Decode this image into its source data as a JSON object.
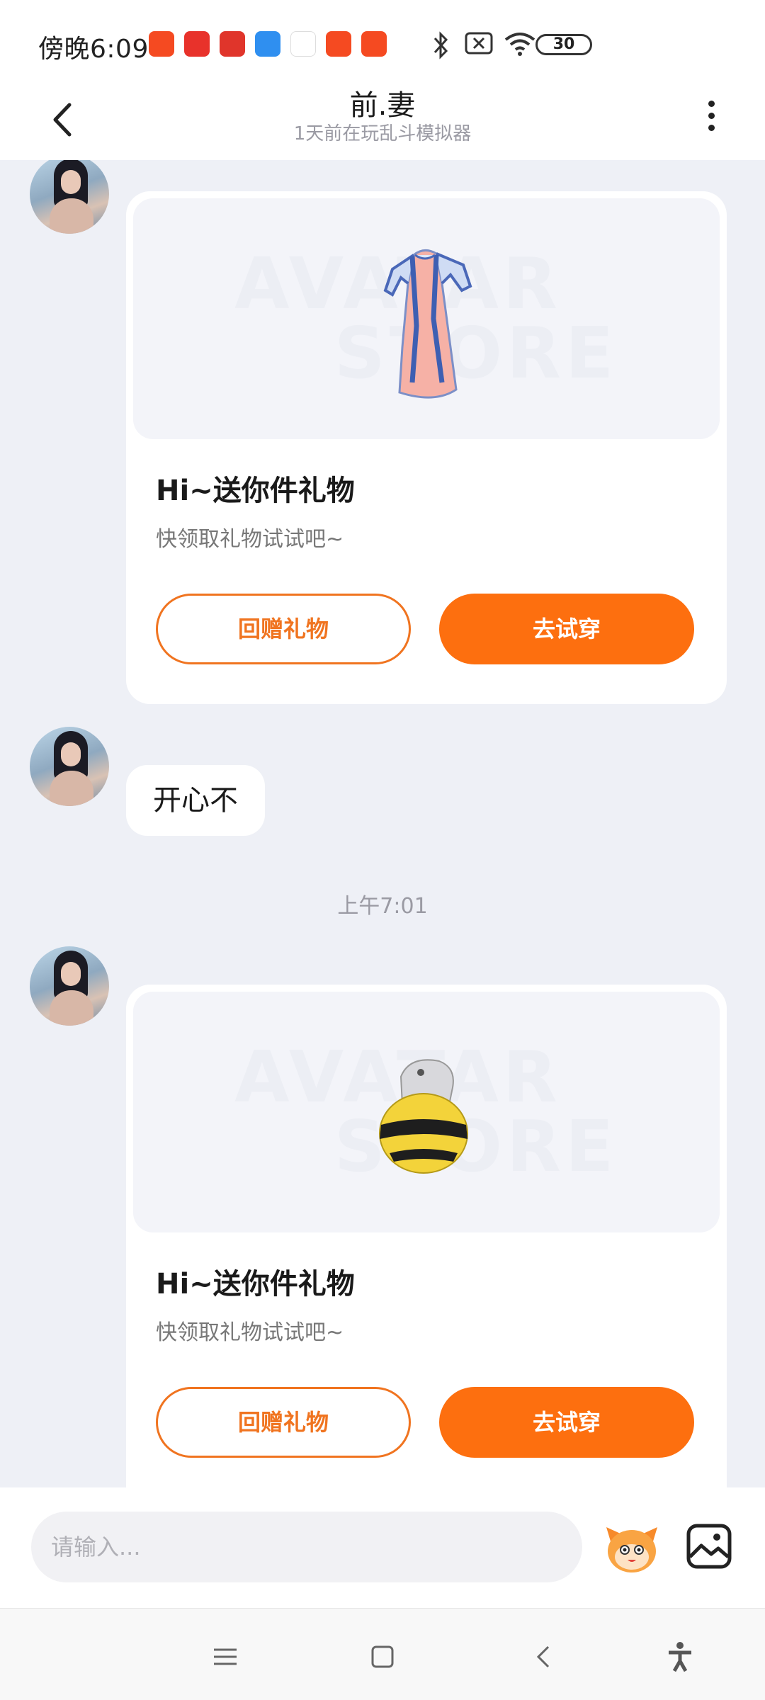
{
  "status_bar": {
    "time": "傍晚6:09",
    "battery": "30",
    "app_icon_colors": [
      "#f54a21",
      "#e8322b",
      "#e0352b",
      "#2f8ff0",
      "#ffffff",
      "#f54a21",
      "#f54a21"
    ],
    "icons": [
      "bluetooth-icon",
      "no-sim-icon",
      "wifi-icon",
      "battery-icon"
    ]
  },
  "header": {
    "title": "前.妻",
    "subtitle": "1天前在玩乱斗模拟器",
    "back_icon": "chevron-left-icon",
    "more_icon": "more-vertical-icon"
  },
  "messages": {
    "gift1": {
      "watermark_top": "AVATAR",
      "watermark_bottom": "STORE",
      "item": "blue-robe",
      "title": "Hi~送你件礼物",
      "description": "快领取礼物试试吧~",
      "return_gift_label": "回赠礼物",
      "try_on_label": "去试穿"
    },
    "text1": "开心不",
    "time_divider": "上午7:01",
    "gift2": {
      "watermark_top": "AVATAR",
      "watermark_bottom": "STORE",
      "item": "bee-bag",
      "title": "Hi~送你件礼物",
      "description": "快领取礼物试试吧~",
      "return_gift_label": "回赠礼物",
      "try_on_label": "去试穿"
    }
  },
  "input": {
    "placeholder": "请输入..."
  },
  "colors": {
    "accent": "#fd6f0f",
    "background": "#eef0f6"
  }
}
